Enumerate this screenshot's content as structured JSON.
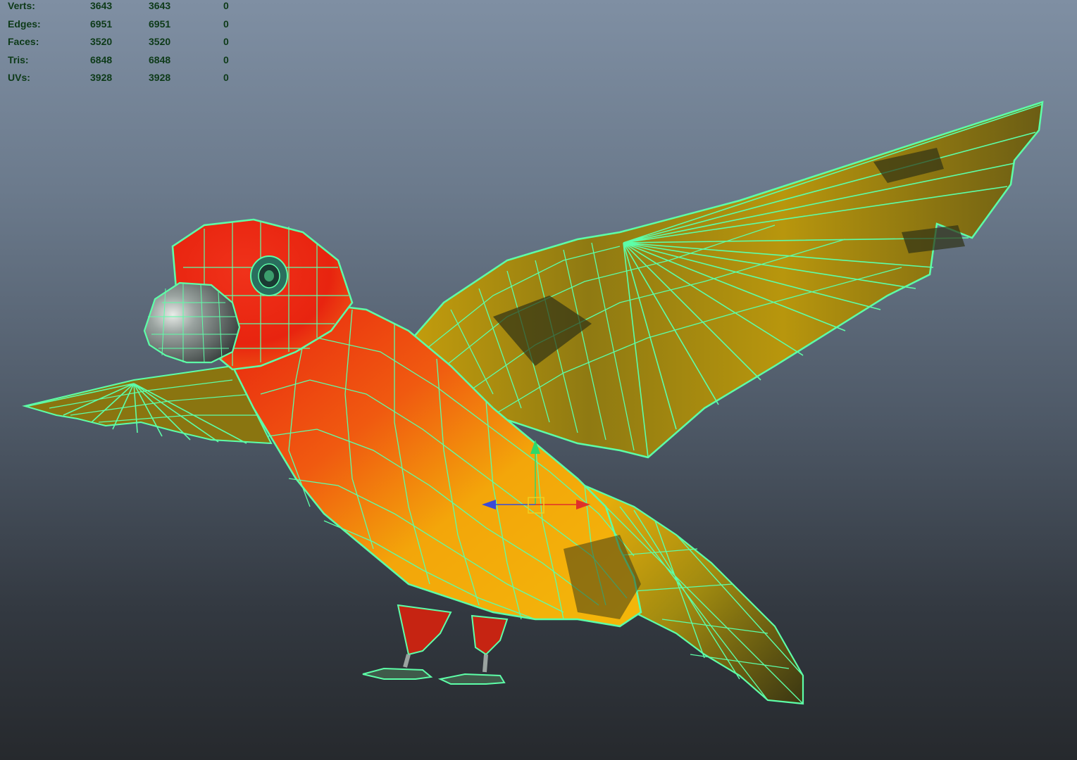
{
  "hud": {
    "rows": [
      {
        "label": "Verts:",
        "v1": "3643",
        "v2": "3643",
        "v3": "0"
      },
      {
        "label": "Edges:",
        "v1": "6951",
        "v2": "6951",
        "v3": "0"
      },
      {
        "label": "Faces:",
        "v1": "3520",
        "v2": "3520",
        "v3": "0"
      },
      {
        "label": "Tris:",
        "v1": "6848",
        "v2": "6848",
        "v3": "0"
      },
      {
        "label": "UVs:",
        "v1": "3928",
        "v2": "3928",
        "v3": "0"
      }
    ]
  },
  "colors": {
    "wireframe": "#5dffa8",
    "head_red": "#e8240f",
    "body_orange": "#f27a10",
    "body_yellow": "#f3b40a",
    "wing_dark": "#3d3a12",
    "hud_text": "#0d3a18"
  },
  "manipulator": {
    "icons": [
      "move-y-arrow-icon",
      "move-x-arrow-icon",
      "move-z-arrow-icon",
      "pivot-square-icon"
    ]
  }
}
